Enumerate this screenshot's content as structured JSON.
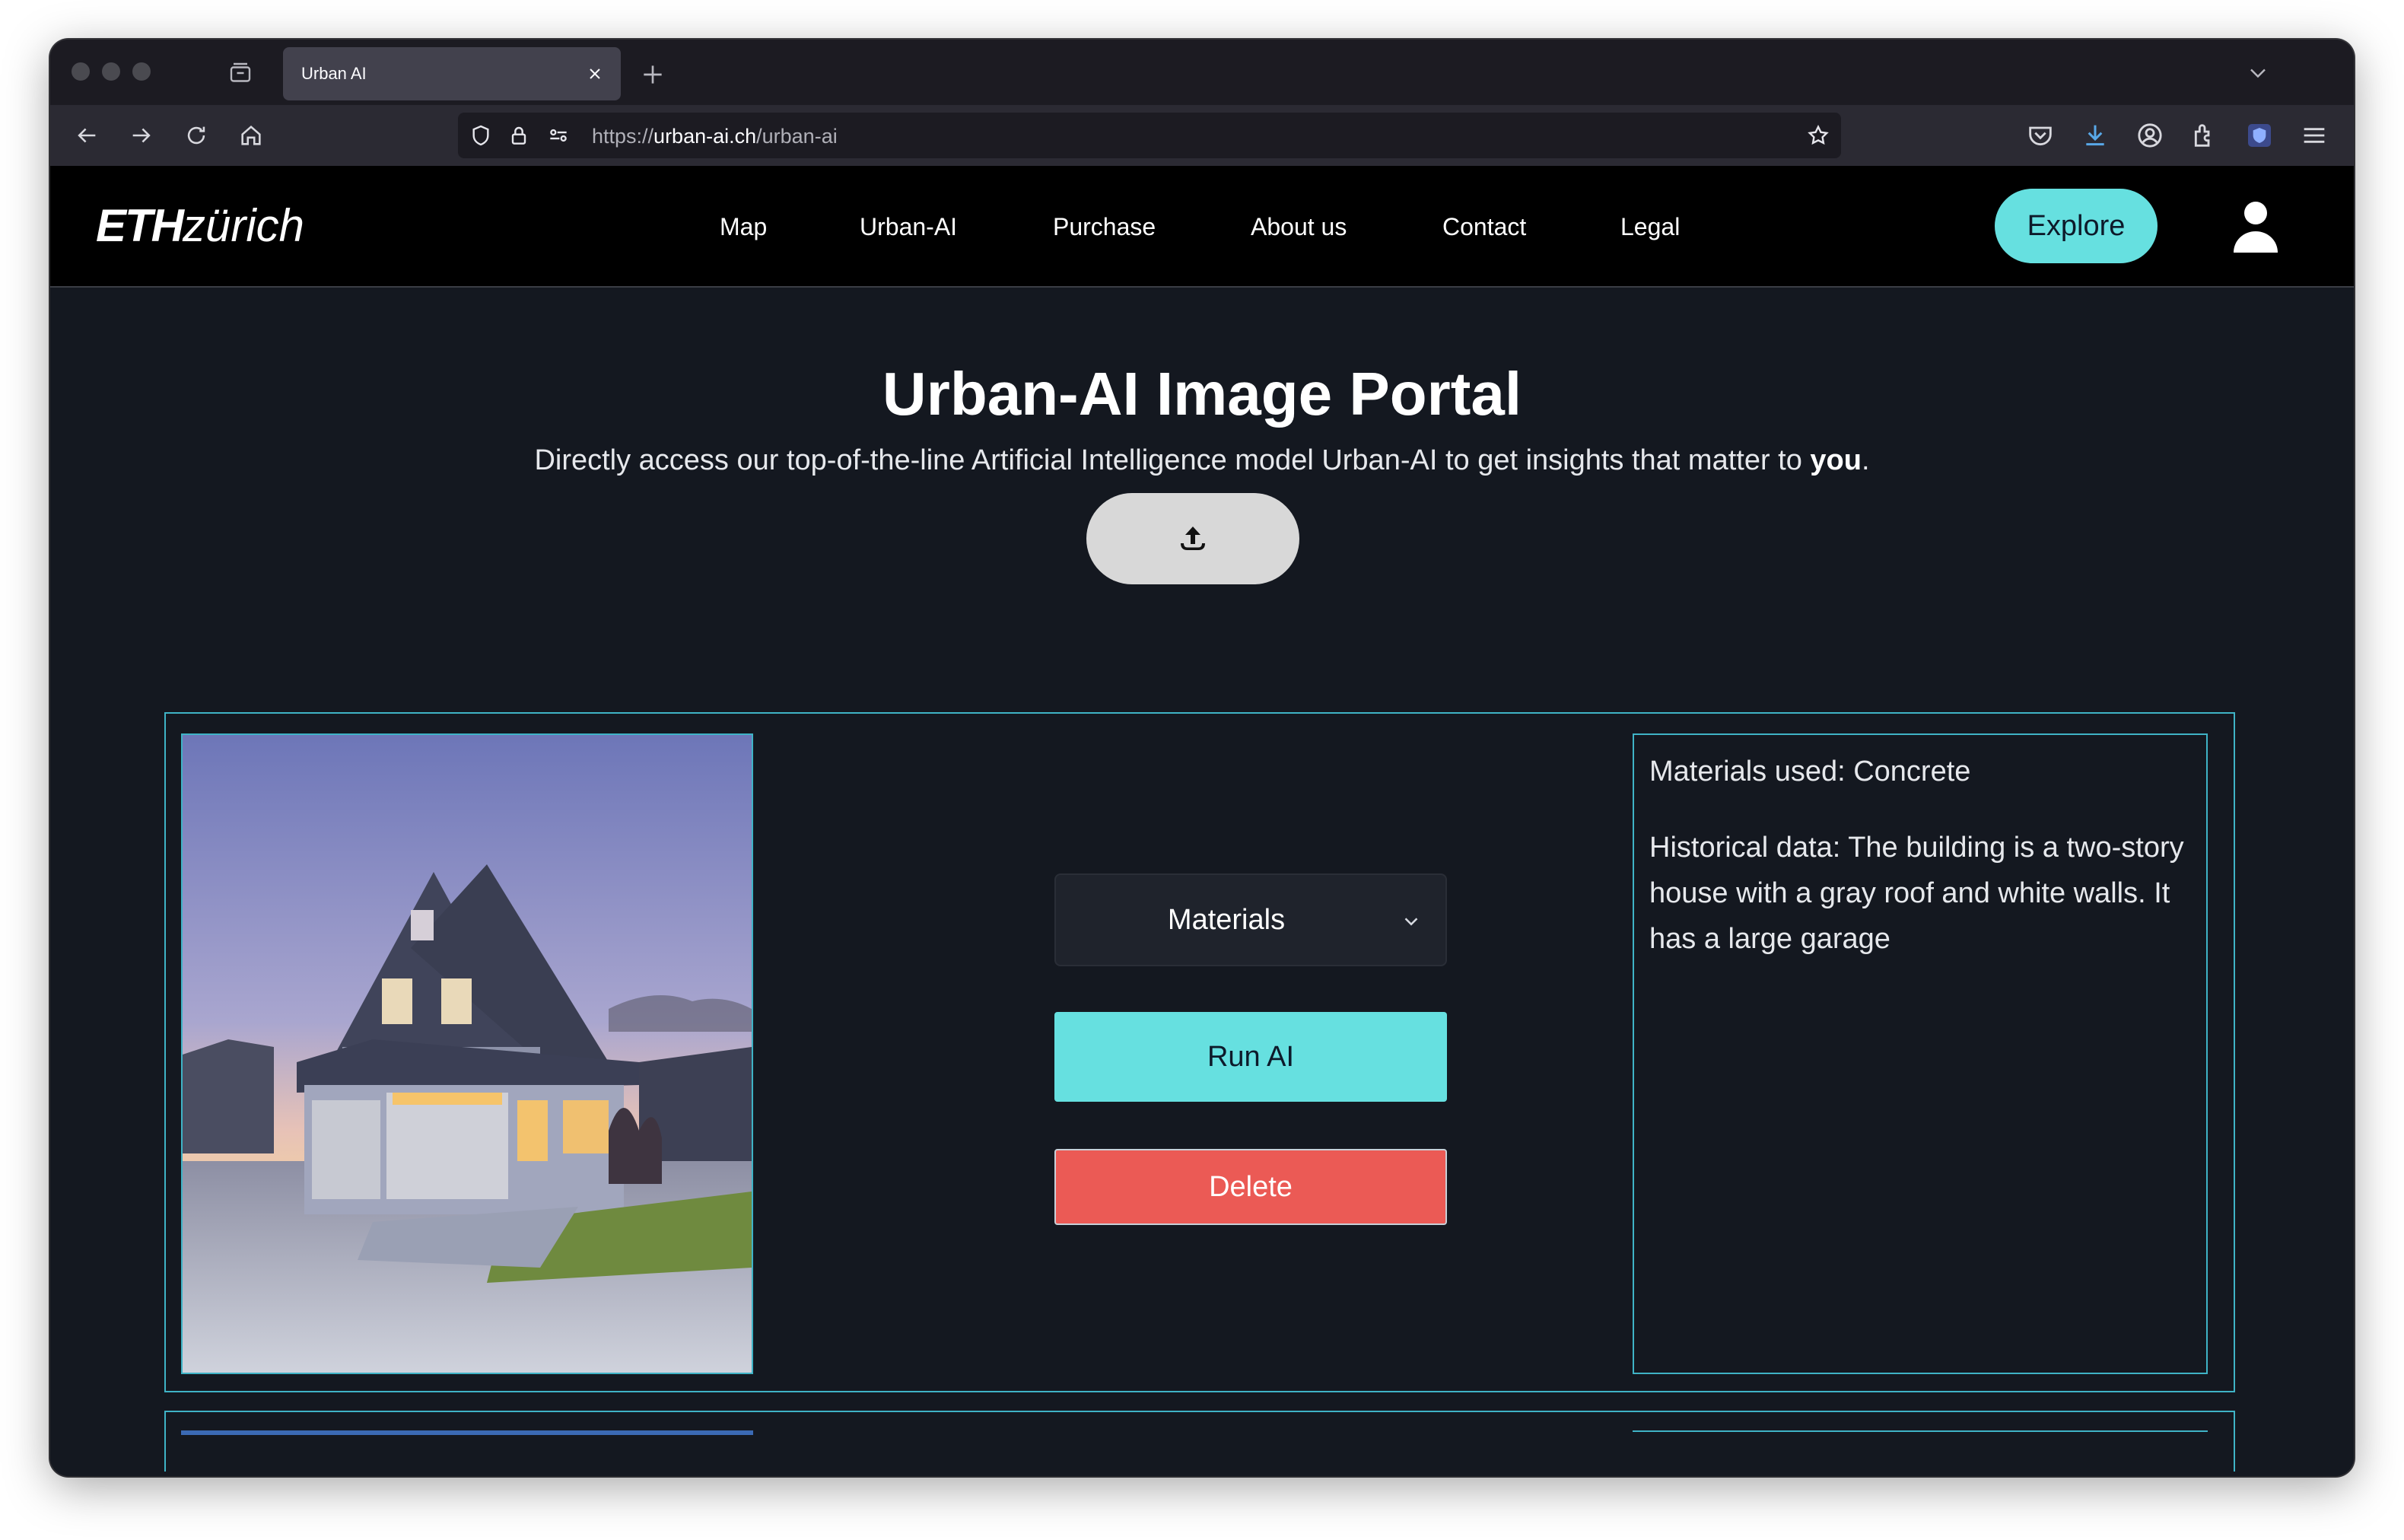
{
  "browser": {
    "tab_title": "Urban AI",
    "url_scheme": "https://",
    "url_host": "urban-ai.ch",
    "url_path": "/urban-ai"
  },
  "site": {
    "logo_bold": "ETH",
    "logo_rest": "zürich",
    "nav": [
      "Map",
      "Urban-AI",
      "Purchase",
      "About us",
      "Contact",
      "Legal"
    ],
    "explore_label": "Explore"
  },
  "page": {
    "title": "Urban-AI Image Portal",
    "subtitle_prefix": "Directly access our top-of-the-line Artificial Intelligence model Urban-AI to get insights that matter to ",
    "subtitle_emphasis": "you",
    "subtitle_suffix": "."
  },
  "result": {
    "select_value": "Materials",
    "run_label": "Run AI",
    "delete_label": "Delete",
    "materials_text": "Materials used: Concrete",
    "history_text": "Historical data: The building is a two-story house with a gray roof and white walls. It has a large garage"
  },
  "colors": {
    "accent": "#66e0e0",
    "danger": "#eb5a55",
    "background": "#141820",
    "card_border": "#3fb3c6"
  },
  "icons": {
    "upload": "upload-icon",
    "user": "user-icon",
    "select": "chevron-down-icon"
  }
}
